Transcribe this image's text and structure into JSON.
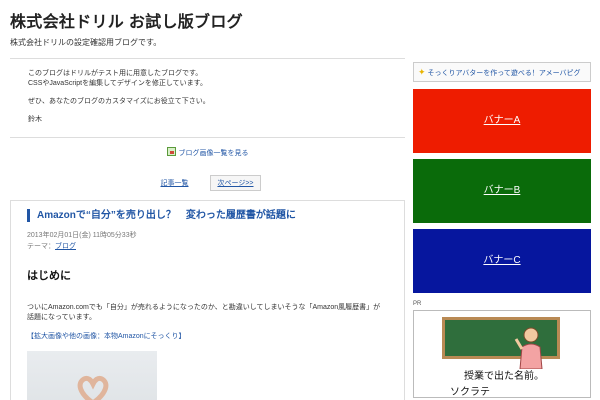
{
  "header": {
    "title": "株式会社ドリル お試し版ブログ",
    "description": "株式会社ドリルの設定確認用ブログです。"
  },
  "intro": {
    "line1": "このブログはドリルがテスト用に用意したブログです。",
    "line2": "CSSやJavaScriptを編集してデザインを修正しています。",
    "line3": "ぜひ、あなたのブログのカスタマイズにお役立て下さい。",
    "signature": "鈴木"
  },
  "image_list": {
    "label": "ブログ画像一覧を見る"
  },
  "pager": {
    "list_label": "記事一覧",
    "next_label": "次ページ>>"
  },
  "entry": {
    "title": "Amazonで“自分”を売り出し？　変わった履歴書が話題に",
    "date": "2013年02月01日(金) 11時05分33秒",
    "theme_label": "テーマ：",
    "theme_value": "ブログ",
    "heading": "はじめに",
    "body": "ついにAmazon.comでも「自分」が売れるようになったのか、と勘違いしてしまいそうな「Amazon風履歴書」が話題になっています。",
    "image_link": "【拡大画像や他の画像：本物Amazonにそっくり】"
  },
  "sidebar": {
    "promo": "そっくりアバターを作って遊べる！アメーバピグ",
    "banners": [
      {
        "label": "バナーA",
        "color": "#ee1c00"
      },
      {
        "label": "バナーB",
        "color": "#0a6b0a"
      },
      {
        "label": "バナーC",
        "color": "#06169e"
      }
    ],
    "pr_label": "PR",
    "pr_line1": "授業で出た名前。",
    "pr_line2": "ソクラテ"
  }
}
